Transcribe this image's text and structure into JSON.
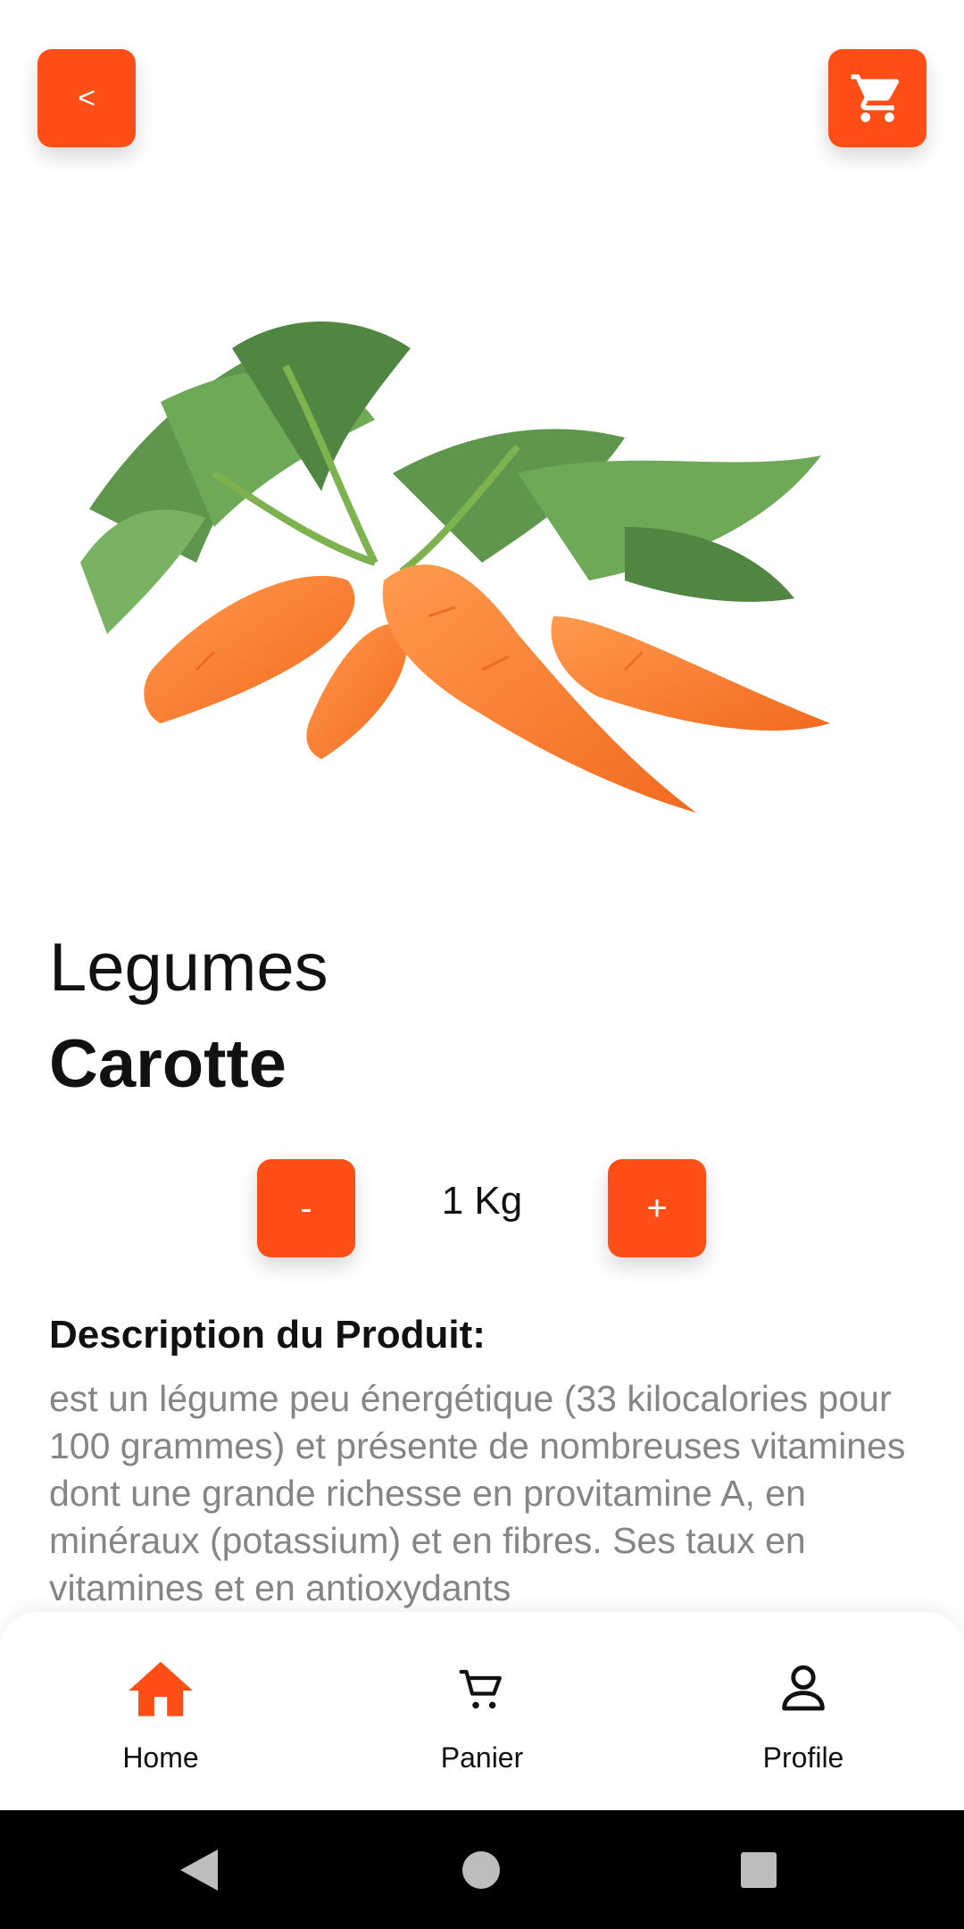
{
  "header": {
    "back_label": "<",
    "cart_icon": "cart-icon"
  },
  "product": {
    "category": "Legumes",
    "name": "Carotte",
    "image_icon": "carrot-image"
  },
  "quantity": {
    "minus_label": "-",
    "plus_label": "+",
    "value": "1 Kg"
  },
  "description": {
    "title": "Description du Produit:",
    "text": "est un légume peu énergétique (33 kilocalories pour 100 grammes) et présente de nombreuses vitamines dont une grande richesse en provitamine A, en minéraux (potassium) et en fibres. Ses taux en vitamines et en antioxydants"
  },
  "nav": {
    "items": [
      {
        "label": "Home",
        "icon": "home-icon",
        "active": true
      },
      {
        "label": "Panier",
        "icon": "cart-icon",
        "active": false
      },
      {
        "label": "Profile",
        "icon": "user-icon",
        "active": false
      }
    ]
  },
  "colors": {
    "accent": "#FF4E16",
    "text": "#111111",
    "muted": "#858585"
  },
  "system": {
    "icons": [
      "back-triangle-icon",
      "home-circle-icon",
      "recents-square-icon"
    ]
  }
}
